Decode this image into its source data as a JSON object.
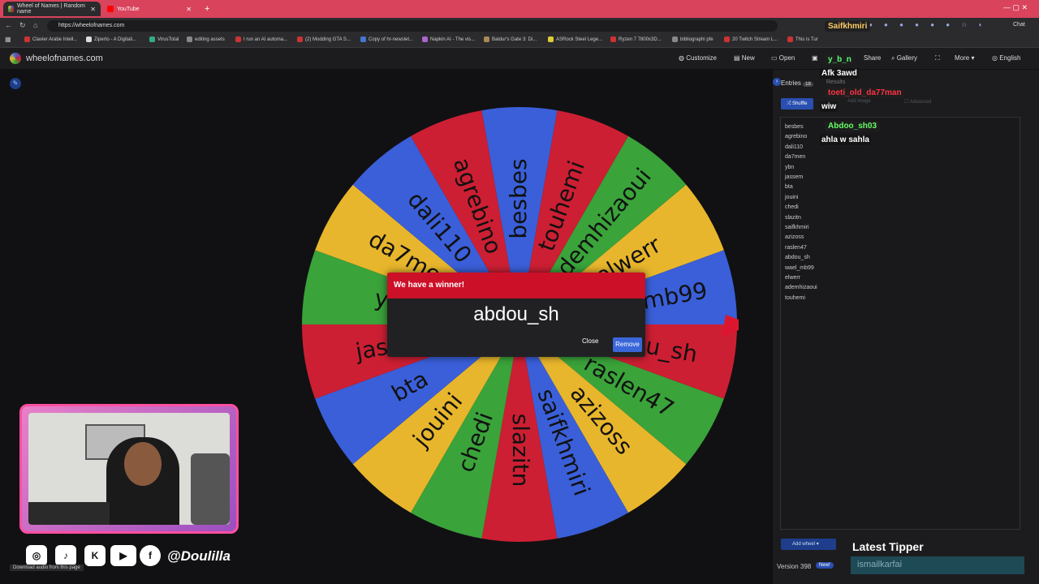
{
  "browser": {
    "tabs": [
      {
        "label": "Wheel of Names | Random name",
        "active": true
      },
      {
        "label": "YouTube",
        "active": false
      }
    ],
    "new_tab": "+",
    "url": "https://wheelofnames.com",
    "bookmarks": [
      "Clavier Arabe Intell...",
      "Ziperto - A Digitali...",
      "VirusTotal",
      "editing assets",
      "I run an AI automa...",
      "(2) Modding GTA S...",
      "Copy of hr-newslet...",
      "Napkin AI - The vis...",
      "Baldur's Gate 3: Di...",
      "ASRock Steel Lege...",
      "Ryzen 7 7800x3D...",
      "bibliographi pfe",
      "20 Twitch Stream L...",
      "This is Tur"
    ],
    "chat_button": "Chat"
  },
  "site": {
    "title": "wheelofnames.com",
    "menu": [
      "Customize",
      "New",
      "Open",
      "Share",
      "Gallery",
      "More",
      "English"
    ],
    "wheel_slices": [
      "besbes",
      "touhemi",
      "ademhizaoui",
      "elwerr",
      "wael_mb99",
      "abdou_sh",
      "raslen47",
      "azizoss",
      "saifkhmiri",
      "slazitn",
      "chedi",
      "jouini",
      "bta",
      "jassem",
      "ybn",
      "da7men",
      "dali110",
      "agrebino"
    ],
    "wheel_colors": [
      "#3a5fd9",
      "#cc1f33",
      "#3aa33a",
      "#e8b62c"
    ]
  },
  "dialog": {
    "title": "We have a winner!",
    "winner": "abdou_sh",
    "close_label": "Close",
    "remove_label": "Remove"
  },
  "sidebar": {
    "entries_tab": "Entries",
    "entries_count": "18",
    "results_tab": "Results",
    "shuffle_label": "Shuffle",
    "add_image_label": "Add image",
    "advanced_label": "Advanced",
    "entries": [
      "besbes",
      "agrebino",
      "dali110",
      "da7men",
      "ybn",
      "jassem",
      "bta",
      "jouini",
      "chedi",
      "slazitn",
      "saifkhmiri",
      "azizoss",
      "raslen47",
      "abdou_sh",
      "wael_mb99",
      "elwerr",
      "ademhizaoui",
      "touhemi"
    ],
    "add_wheel_label": "Add wheel",
    "version": "Version 398",
    "new_badge": "New!"
  },
  "chat": [
    {
      "name": "Saifkhmiri",
      "color": "#ffcc66",
      "message": ""
    },
    {
      "name": "y_b_n",
      "color": "#55ff77",
      "message": "Afk 3awd"
    },
    {
      "name": "toeti_old_da77man",
      "color": "#ff3344",
      "message": "wiw"
    },
    {
      "name": "Abdoo_sh03",
      "color": "#66ff66",
      "message": "ahla w sahla"
    }
  ],
  "overlay": {
    "handle": "@Doulilla",
    "latest_tipper_title": "Latest Tipper",
    "latest_tipper_name": "ismailkarfai",
    "download_audio": "Download audio from this page"
  }
}
